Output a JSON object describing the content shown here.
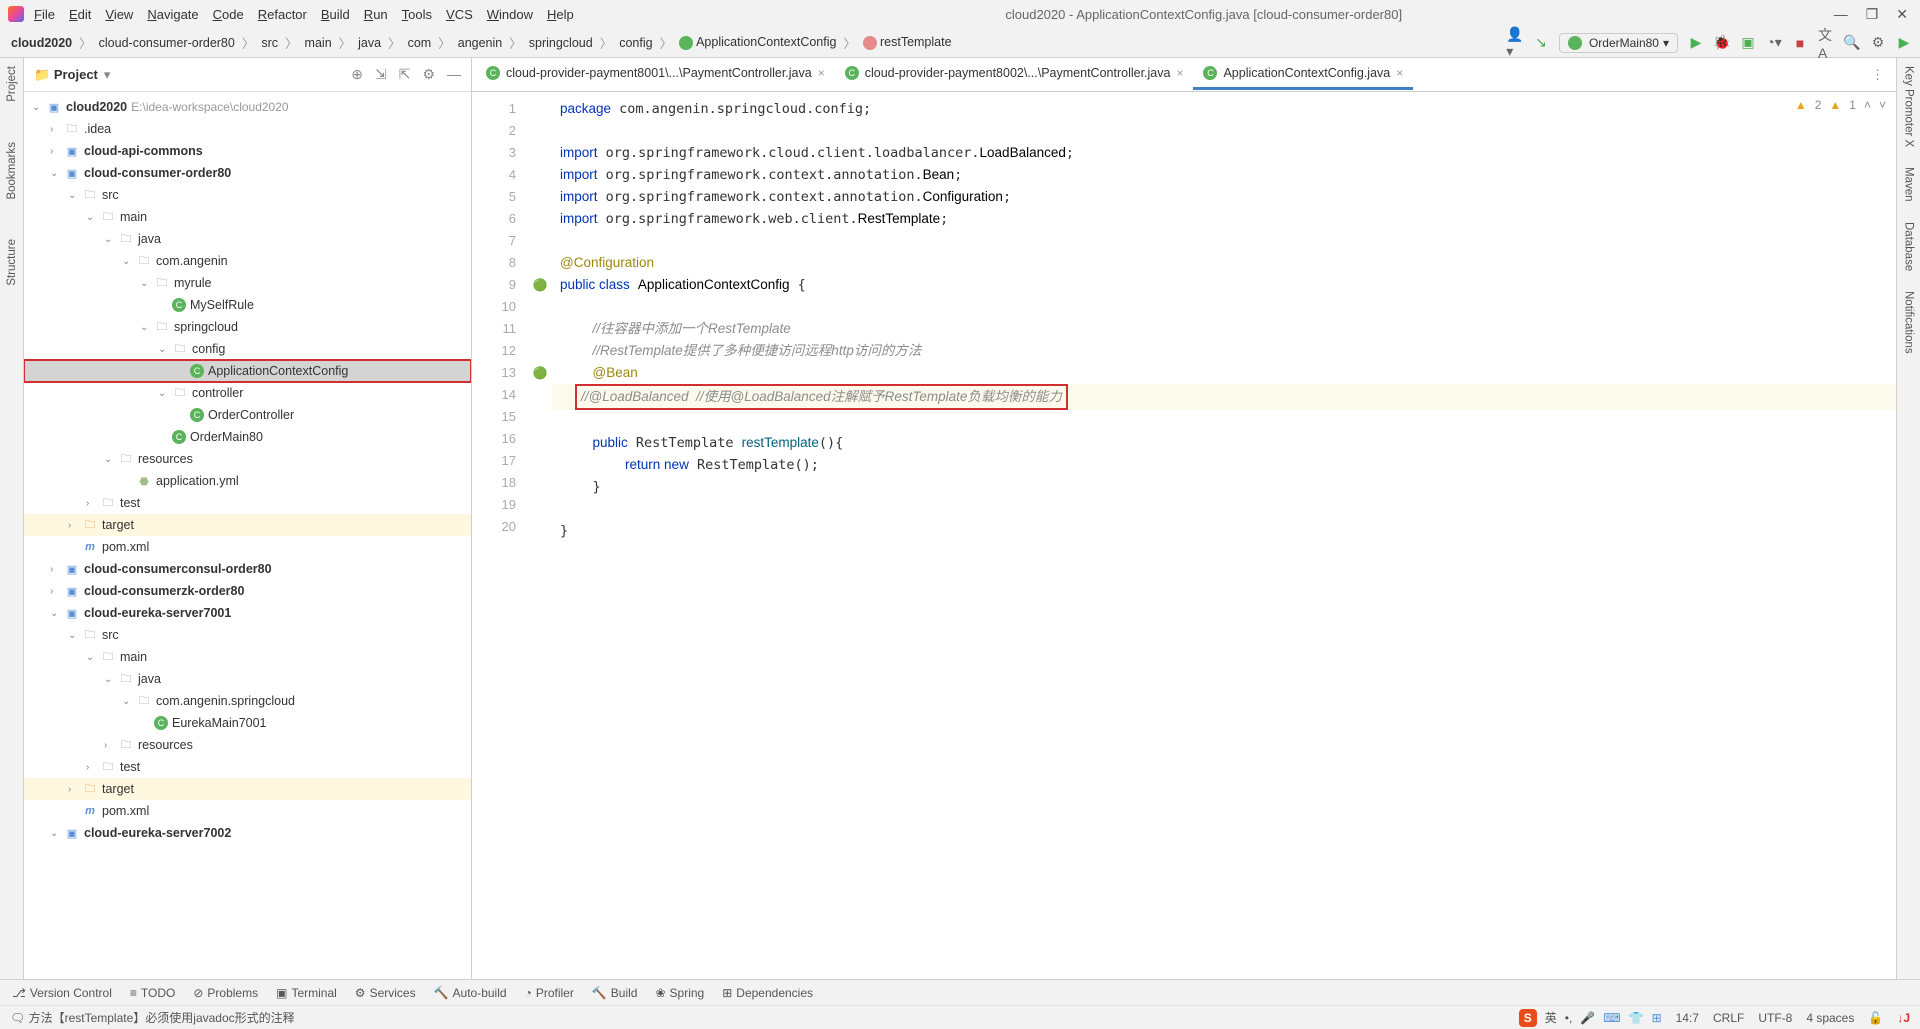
{
  "window": {
    "title": "cloud2020 - ApplicationContextConfig.java [cloud-consumer-order80]"
  },
  "menu": [
    "File",
    "Edit",
    "View",
    "Navigate",
    "Code",
    "Refactor",
    "Build",
    "Run",
    "Tools",
    "VCS",
    "Window",
    "Help"
  ],
  "breadcrumb": [
    "cloud2020",
    "cloud-consumer-order80",
    "src",
    "main",
    "java",
    "com",
    "angenin",
    "springcloud",
    "config",
    "ApplicationContextConfig",
    "restTemplate"
  ],
  "runConfig": "OrderMain80",
  "sidebar": {
    "title": "Project",
    "root": {
      "name": "cloud2020",
      "path": "E:\\idea-workspace\\cloud2020"
    },
    "items": [
      {
        "indent": 1,
        "arrow": ">",
        "icon": "folder",
        "label": ".idea"
      },
      {
        "indent": 1,
        "arrow": ">",
        "icon": "module",
        "label": "cloud-api-commons",
        "bold": true
      },
      {
        "indent": 1,
        "arrow": "v",
        "icon": "module",
        "label": "cloud-consumer-order80",
        "bold": true
      },
      {
        "indent": 2,
        "arrow": "v",
        "icon": "folder",
        "label": "src"
      },
      {
        "indent": 3,
        "arrow": "v",
        "icon": "folder",
        "label": "main"
      },
      {
        "indent": 4,
        "arrow": "v",
        "icon": "folder",
        "label": "java"
      },
      {
        "indent": 5,
        "arrow": "v",
        "icon": "folder",
        "label": "com.angenin"
      },
      {
        "indent": 6,
        "arrow": "v",
        "icon": "folder",
        "label": "myrule"
      },
      {
        "indent": 7,
        "arrow": "",
        "icon": "java-c",
        "label": "MySelfRule"
      },
      {
        "indent": 6,
        "arrow": "v",
        "icon": "folder",
        "label": "springcloud"
      },
      {
        "indent": 7,
        "arrow": "v",
        "icon": "folder",
        "label": "config"
      },
      {
        "indent": 8,
        "arrow": "",
        "icon": "java-c",
        "label": "ApplicationContextConfig",
        "selected": true,
        "highlighted": true
      },
      {
        "indent": 7,
        "arrow": "v",
        "icon": "folder",
        "label": "controller"
      },
      {
        "indent": 8,
        "arrow": "",
        "icon": "java-c",
        "label": "OrderController"
      },
      {
        "indent": 7,
        "arrow": "",
        "icon": "java-c",
        "label": "OrderMain80"
      },
      {
        "indent": 4,
        "arrow": "v",
        "icon": "folder",
        "label": "resources"
      },
      {
        "indent": 5,
        "arrow": "",
        "icon": "yml",
        "label": "application.yml"
      },
      {
        "indent": 3,
        "arrow": ">",
        "icon": "folder",
        "label": "test"
      },
      {
        "indent": 2,
        "arrow": ">",
        "icon": "target",
        "label": "target",
        "tgt": true
      },
      {
        "indent": 2,
        "arrow": "",
        "icon": "xml-m",
        "label": "pom.xml"
      },
      {
        "indent": 1,
        "arrow": ">",
        "icon": "module",
        "label": "cloud-consumerconsul-order80",
        "bold": true
      },
      {
        "indent": 1,
        "arrow": ">",
        "icon": "module",
        "label": "cloud-consumerzk-order80",
        "bold": true
      },
      {
        "indent": 1,
        "arrow": "v",
        "icon": "module",
        "label": "cloud-eureka-server7001",
        "bold": true
      },
      {
        "indent": 2,
        "arrow": "v",
        "icon": "folder",
        "label": "src"
      },
      {
        "indent": 3,
        "arrow": "v",
        "icon": "folder",
        "label": "main"
      },
      {
        "indent": 4,
        "arrow": "v",
        "icon": "folder",
        "label": "java"
      },
      {
        "indent": 5,
        "arrow": "v",
        "icon": "folder",
        "label": "com.angenin.springcloud"
      },
      {
        "indent": 6,
        "arrow": "",
        "icon": "java-c",
        "label": "EurekaMain7001"
      },
      {
        "indent": 4,
        "arrow": ">",
        "icon": "folder",
        "label": "resources"
      },
      {
        "indent": 3,
        "arrow": ">",
        "icon": "folder",
        "label": "test"
      },
      {
        "indent": 2,
        "arrow": ">",
        "icon": "target",
        "label": "target",
        "tgt": true
      },
      {
        "indent": 2,
        "arrow": "",
        "icon": "xml-m",
        "label": "pom.xml"
      },
      {
        "indent": 1,
        "arrow": "v",
        "icon": "module",
        "label": "cloud-eureka-server7002",
        "bold": true
      }
    ]
  },
  "tabs": [
    {
      "label": "cloud-provider-payment8001\\...\\PaymentController.java",
      "active": false
    },
    {
      "label": "cloud-provider-payment8002\\...\\PaymentController.java",
      "active": false
    },
    {
      "label": "ApplicationContextConfig.java",
      "active": true
    }
  ],
  "warnings": {
    "yellow": "2",
    "orange": "1"
  },
  "code": {
    "lines": [
      {
        "n": 1,
        "html": "<span class='kw'>package</span> com.angenin.springcloud.config;"
      },
      {
        "n": 2,
        "html": ""
      },
      {
        "n": 3,
        "html": "<span class='kw'>import</span> org.springframework.cloud.client.loadbalancer.<span class='imp-cls'>LoadBalanced</span>;"
      },
      {
        "n": 4,
        "html": "<span class='kw'>import</span> org.springframework.context.annotation.<span class='imp-cls'>Bean</span>;"
      },
      {
        "n": 5,
        "html": "<span class='kw'>import</span> org.springframework.context.annotation.<span class='imp-cls'>Configuration</span>;"
      },
      {
        "n": 6,
        "html": "<span class='kw'>import</span> org.springframework.web.client.<span class='imp-cls'>RestTemplate</span>;"
      },
      {
        "n": 7,
        "html": ""
      },
      {
        "n": 8,
        "html": "<span class='ann'>@Configuration</span>"
      },
      {
        "n": 9,
        "html": "<span class='kw'>public class</span> <span class='clsname'>ApplicationContextConfig</span> {",
        "mark": "🟢"
      },
      {
        "n": 10,
        "html": ""
      },
      {
        "n": 11,
        "html": "    <span class='comment'>//往容器中添加一个RestTemplate</span>"
      },
      {
        "n": 12,
        "html": "    <span class='comment'>//RestTemplate提供了多种便捷访问远程http访问的方法</span>"
      },
      {
        "n": 13,
        "html": "    <span class='ann'>@Bean</span>",
        "mark": "🟢"
      },
      {
        "n": 14,
        "html": "    <span class='red-box'><span class='comment'>//@LoadBalanced  //使用@LoadBalanced注解赋予RestTemplate负载均衡的能力</span></span>",
        "hl": true
      },
      {
        "n": 15,
        "html": "    <span class='kw'>public</span> RestTemplate <span class='method'>restTemplate</span>(){"
      },
      {
        "n": 16,
        "html": "        <span class='kw'>return new</span> RestTemplate();"
      },
      {
        "n": 17,
        "html": "    }"
      },
      {
        "n": 18,
        "html": ""
      },
      {
        "n": 19,
        "html": "}"
      },
      {
        "n": 20,
        "html": ""
      }
    ]
  },
  "bottomTools": [
    "Version Control",
    "TODO",
    "Problems",
    "Terminal",
    "Services",
    "Auto-build",
    "Profiler",
    "Build",
    "Spring",
    "Dependencies"
  ],
  "statusMsg": "方法【restTemplate】必须使用javadoc形式的注释",
  "status": {
    "pos": "14:7",
    "eol": "CRLF",
    "enc": "UTF-8",
    "indent": "4 spaces"
  },
  "leftTools": [
    "Project",
    "Bookmarks",
    "Structure"
  ],
  "rightTools": [
    "Key Promoter X",
    "Maven",
    "Database",
    "Notifications"
  ]
}
